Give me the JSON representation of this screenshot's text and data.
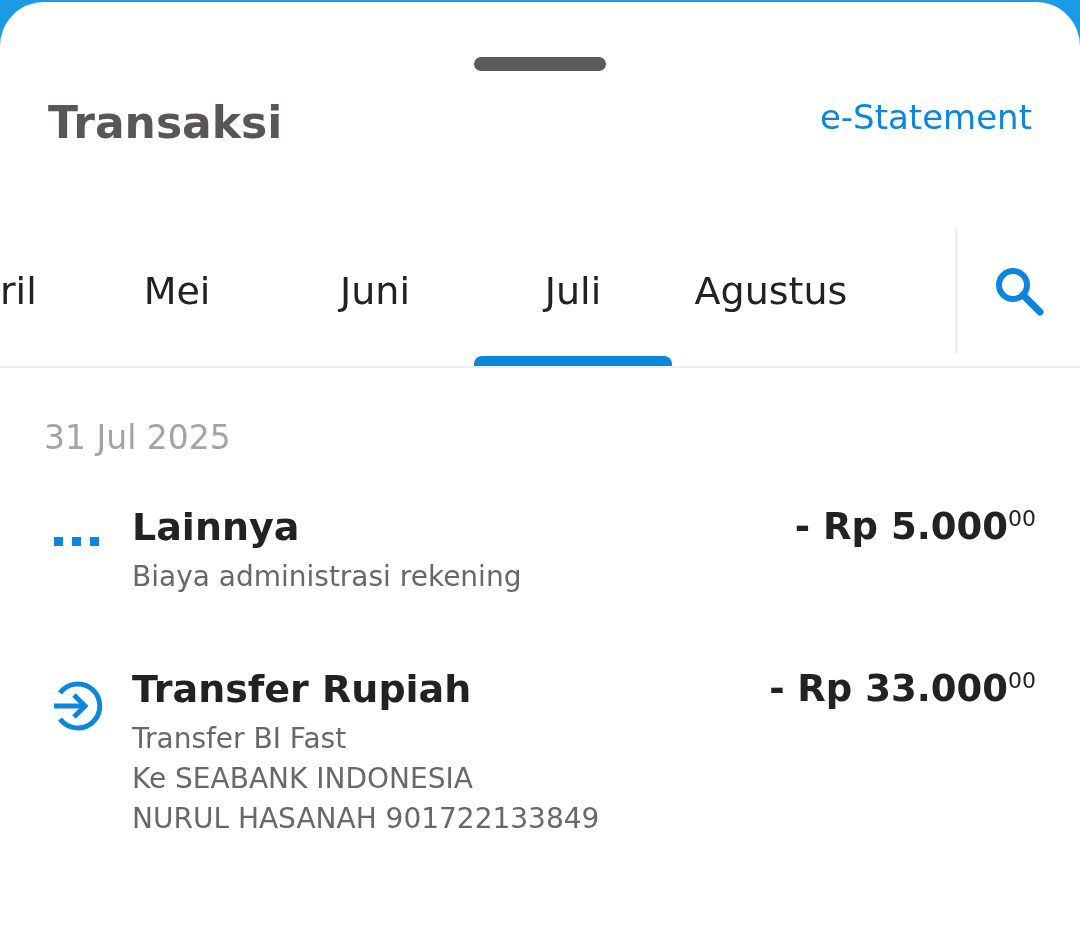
{
  "header": {
    "title": "Transaksi",
    "link": "e-Statement"
  },
  "tabs": [
    {
      "label": "ril",
      "selected": false
    },
    {
      "label": "Mei",
      "selected": false
    },
    {
      "label": "Juni",
      "selected": false
    },
    {
      "label": "Juli",
      "selected": true
    },
    {
      "label": "Agustus",
      "selected": false
    }
  ],
  "groups": [
    {
      "date": "31 Jul 2025",
      "transactions": [
        {
          "kind": "other",
          "title": "Lainnya",
          "amount": "- Rp 5.000$^{00}$",
          "details": [
            "Biaya administrasi rekening"
          ]
        },
        {
          "kind": "transfer",
          "title": "Transfer Rupiah",
          "amount": "- Rp 33.000$^{00}$",
          "details": [
            "Transfer BI Fast",
            "Ke SEABANK INDONESIA",
            "NURUL HASANAH 901722133849"
          ]
        }
      ]
    }
  ]
}
